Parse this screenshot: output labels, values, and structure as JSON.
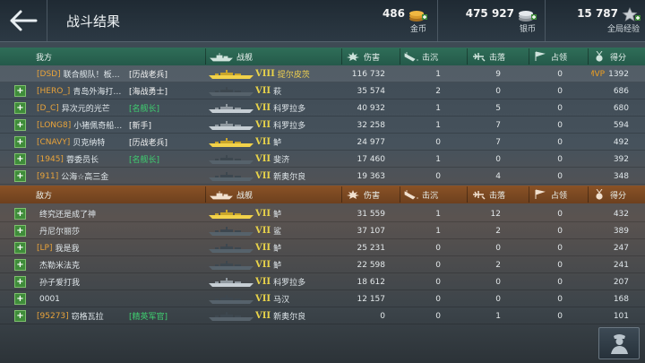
{
  "page": {
    "title": "战斗结果"
  },
  "resources": {
    "gold": {
      "value": "486",
      "label": "金币",
      "icon": "gold-coin-icon"
    },
    "silver": {
      "value": "475 927",
      "label": "银币",
      "icon": "silver-coin-icon"
    },
    "exp": {
      "value": "15 787",
      "label": "全局经验",
      "icon": "star-exp-icon"
    }
  },
  "columns": {
    "ours_label": "我方",
    "enemy_label": "敌方",
    "ship": "战舰",
    "damage": "伤害",
    "kills": "击沉",
    "planes": "击落",
    "capture": "占领",
    "score": "得分"
  },
  "colors": {
    "ours_header": "#2f6e58",
    "enemy_header": "#8a5226",
    "clan": "#e9a33a",
    "tag_veteran": "#ffffff",
    "tag_famous": "#3fd070",
    "tier": "#e8d34a",
    "mvp": "#f0a020"
  },
  "ours": [
    {
      "plus": false,
      "clan": "[DSD]",
      "name": "联合舰队！板…",
      "tag": "[历战老兵]",
      "tag_color": "#f4f4f4",
      "ship_color": "gold",
      "tier": "VIII",
      "ship": "提尔皮茨",
      "ship_color_text": "#f0d050",
      "damage": "116 732",
      "kills": "1",
      "planes": "9",
      "capture": "0",
      "mvp": "MVP",
      "score": "1392"
    },
    {
      "plus": true,
      "clan": "[HERO_]",
      "name": "青岛外海打…",
      "tag": "[海战勇士]",
      "tag_color": "#f4f4f4",
      "ship_color": "dark",
      "tier": "VII",
      "ship": "萩",
      "ship_color_text": "#dfe6ea",
      "damage": "35 574",
      "kills": "2",
      "planes": "0",
      "capture": "0",
      "mvp": "",
      "score": "686"
    },
    {
      "plus": true,
      "clan": "[D_C]",
      "name": "异次元的光芒",
      "tag": "[名舰长]",
      "tag_color": "#3fd070",
      "ship_color": "grey",
      "tier": "VII",
      "ship": "科罗拉多",
      "ship_color_text": "#dfe6ea",
      "damage": "40 932",
      "kills": "1",
      "planes": "5",
      "capture": "0",
      "mvp": "",
      "score": "680"
    },
    {
      "plus": true,
      "clan": "[LONG8]",
      "name": "小猪佩奇船…",
      "tag": "[新手]",
      "tag_color": "#f4f4f4",
      "ship_color": "grey",
      "tier": "VII",
      "ship": "科罗拉多",
      "ship_color_text": "#dfe6ea",
      "damage": "32 258",
      "kills": "1",
      "planes": "7",
      "capture": "0",
      "mvp": "",
      "score": "594"
    },
    {
      "plus": true,
      "clan": "[CNAVY]",
      "name": "贝克纳特",
      "tag": "[历战老兵]",
      "tag_color": "#f4f4f4",
      "ship_color": "gold",
      "tier": "VII",
      "ship": "鲈",
      "ship_color_text": "#dfe6ea",
      "damage": "24 977",
      "kills": "0",
      "planes": "7",
      "capture": "0",
      "mvp": "",
      "score": "492"
    },
    {
      "plus": true,
      "clan": "[1945]",
      "name": "蓉委员长",
      "tag": "[名舰长]",
      "tag_color": "#3fd070",
      "ship_color": "dark",
      "tier": "VII",
      "ship": "斐济",
      "ship_color_text": "#dfe6ea",
      "damage": "17 460",
      "kills": "1",
      "planes": "0",
      "capture": "0",
      "mvp": "",
      "score": "392"
    },
    {
      "plus": true,
      "clan": "[911]",
      "name": "公海☆高三金",
      "tag": "",
      "tag_color": "#f4f4f4",
      "ship_color": "dark",
      "tier": "VII",
      "ship": "新奥尔良",
      "ship_color_text": "#dfe6ea",
      "damage": "19 363",
      "kills": "0",
      "planes": "4",
      "capture": "0",
      "mvp": "",
      "score": "348"
    }
  ],
  "enemy": [
    {
      "plus": true,
      "clan": "",
      "name": "终究还是成了神",
      "tag": "",
      "tag_color": "#f4f4f4",
      "ship_color": "gold",
      "tier": "VII",
      "ship": "鲈",
      "ship_color_text": "#dfe6ea",
      "damage": "31 559",
      "kills": "1",
      "planes": "12",
      "capture": "0",
      "mvp": "",
      "score": "432"
    },
    {
      "plus": true,
      "clan": "",
      "name": "丹尼尔丽莎",
      "tag": "",
      "tag_color": "#f4f4f4",
      "ship_color": "dark",
      "tier": "VII",
      "ship": "鲨",
      "ship_color_text": "#dfe6ea",
      "damage": "37 107",
      "kills": "1",
      "planes": "2",
      "capture": "0",
      "mvp": "",
      "score": "389"
    },
    {
      "plus": true,
      "clan": "[LP]",
      "name": "我是我",
      "tag": "",
      "tag_color": "#f4f4f4",
      "ship_color": "dark",
      "tier": "VII",
      "ship": "鲈",
      "ship_color_text": "#dfe6ea",
      "damage": "25 231",
      "kills": "0",
      "planes": "0",
      "capture": "0",
      "mvp": "",
      "score": "247"
    },
    {
      "plus": true,
      "clan": "",
      "name": "杰勒米法克",
      "tag": "",
      "tag_color": "#f4f4f4",
      "ship_color": "dark",
      "tier": "VII",
      "ship": "鲈",
      "ship_color_text": "#dfe6ea",
      "damage": "22 598",
      "kills": "0",
      "planes": "2",
      "capture": "0",
      "mvp": "",
      "score": "241"
    },
    {
      "plus": true,
      "clan": "",
      "name": "孙子爱打我",
      "tag": "",
      "tag_color": "#f4f4f4",
      "ship_color": "grey",
      "tier": "VII",
      "ship": "科罗拉多",
      "ship_color_text": "#dfe6ea",
      "damage": "18 612",
      "kills": "0",
      "planes": "0",
      "capture": "0",
      "mvp": "",
      "score": "207"
    },
    {
      "plus": true,
      "clan": "",
      "name": "0001",
      "tag": "",
      "tag_color": "#f4f4f4",
      "ship_color": "dark",
      "tier": "VII",
      "ship": "马汉",
      "ship_color_text": "#dfe6ea",
      "damage": "12 157",
      "kills": "0",
      "planes": "0",
      "capture": "0",
      "mvp": "",
      "score": "168"
    },
    {
      "plus": true,
      "clan": "[95273]",
      "name": "窃格瓦拉",
      "tag": "[精英军官]",
      "tag_color": "#3fd070",
      "ship_color": "dark",
      "tier": "VII",
      "ship": "新奥尔良",
      "ship_color_text": "#dfe6ea",
      "damage": "0",
      "kills": "0",
      "planes": "1",
      "capture": "0",
      "mvp": "",
      "score": "101"
    }
  ]
}
